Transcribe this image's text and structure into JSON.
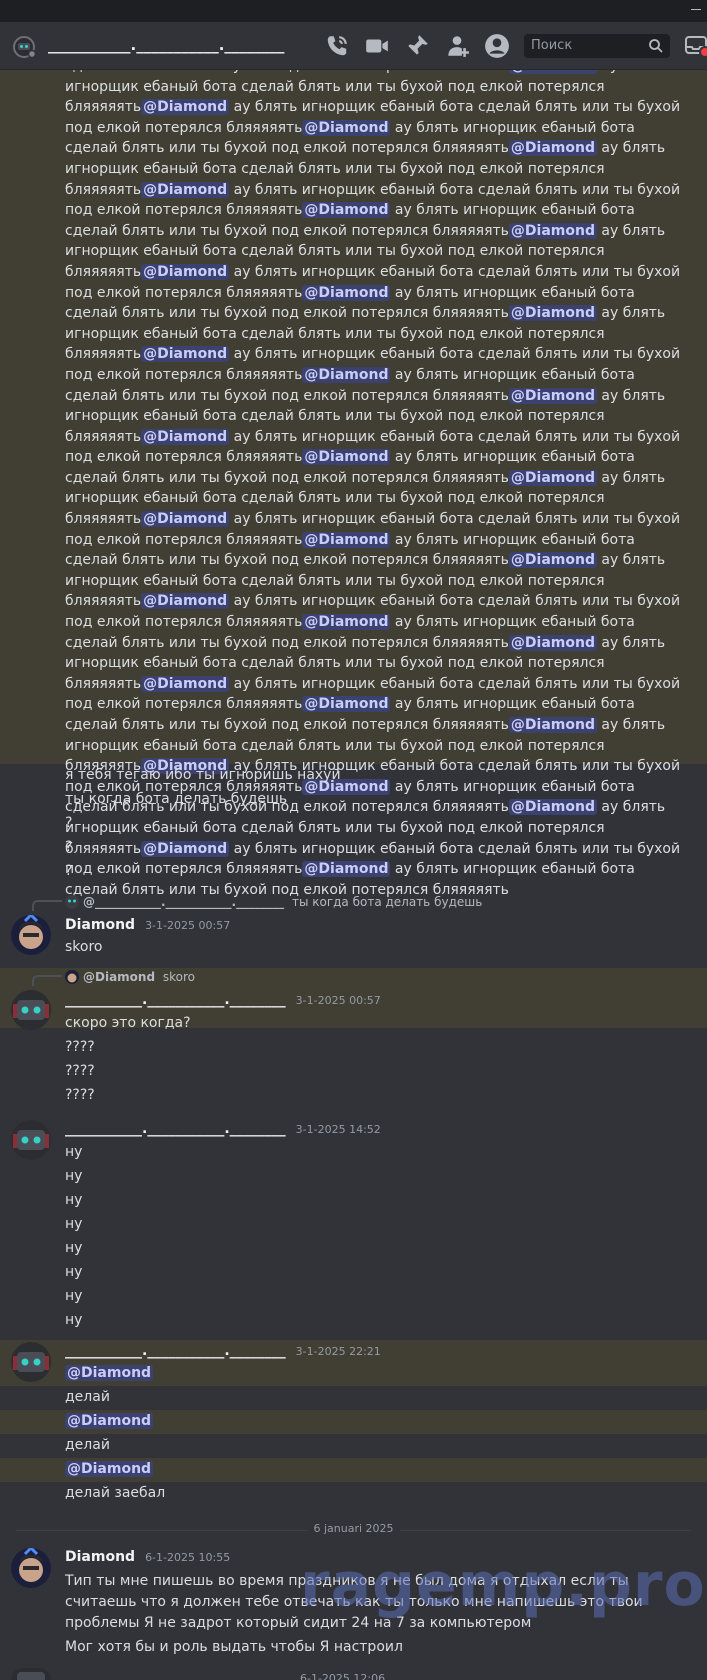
{
  "header": {
    "channel_title": "___________.___________.________",
    "search_placeholder": "Поиск",
    "icons": [
      "phone-icon",
      "video-icon",
      "pin-icon",
      "add-member-icon",
      "profile-icon",
      "search-icon",
      "inbox-icon"
    ]
  },
  "spam": {
    "phrase": " ау блять игнорщик ебаный бота сделай блять или ты бухой под елкой потерялся бляяяяять",
    "lead": "сделай блять или ты бухой под елкой потерялся бляяяяять",
    "mention": "@Diamond",
    "tail": " ау блять игнорщик ебаный бота сделай блять или ты бухой под елкой потерялся бляяяяять"
  },
  "messages_a": {
    "line1": "я тебя тегаю ибо ты игноришь нахуй",
    "line2": "ты когда бота делать будешь",
    "line3": "?",
    "line4": "?",
    "line5": "?"
  },
  "reply1": {
    "mention": "@___________.___________.________",
    "text": "ты когда бота делать будешь"
  },
  "diamond1": {
    "name": "Diamond",
    "time": "3-1-2025 00:57",
    "text": "skoro"
  },
  "reply2": {
    "mention": "@Diamond",
    "text": "skoro"
  },
  "user2": {
    "name": "___________.___________.________",
    "time": "3-1-2025 00:57",
    "lines": [
      "скоро это когда?",
      "????",
      "????",
      "????"
    ]
  },
  "user3": {
    "name": "___________.___________.________",
    "time": "3-1-2025 14:52",
    "lines": [
      "ну",
      "ну",
      "ну",
      "ну",
      "ну",
      "ну",
      "ну",
      "ну"
    ]
  },
  "user4": {
    "name": "___________.___________.________",
    "time": "3-1-2025 22:21",
    "mention": "@Diamond",
    "l1": "делай",
    "l2": "делай",
    "l3": "делай заебал"
  },
  "date_divider": "6 januari 2025",
  "diamond2": {
    "name": "Diamond",
    "time": "6-1-2025 10:55",
    "text": "Тип ты мне пишешь во время праздников я не был дома я отдыхал если ты считаешь что я должен тебе отвечать как ты только мне напишешь это твои проблемы Я не задрот который сидит 24 на 7 за компьютером",
    "text2": "Мог хотя бы и роль выдать чтобы Я настроил"
  },
  "next_time": "6-1-2025 12:06",
  "watermark": "ragemp.pro"
}
